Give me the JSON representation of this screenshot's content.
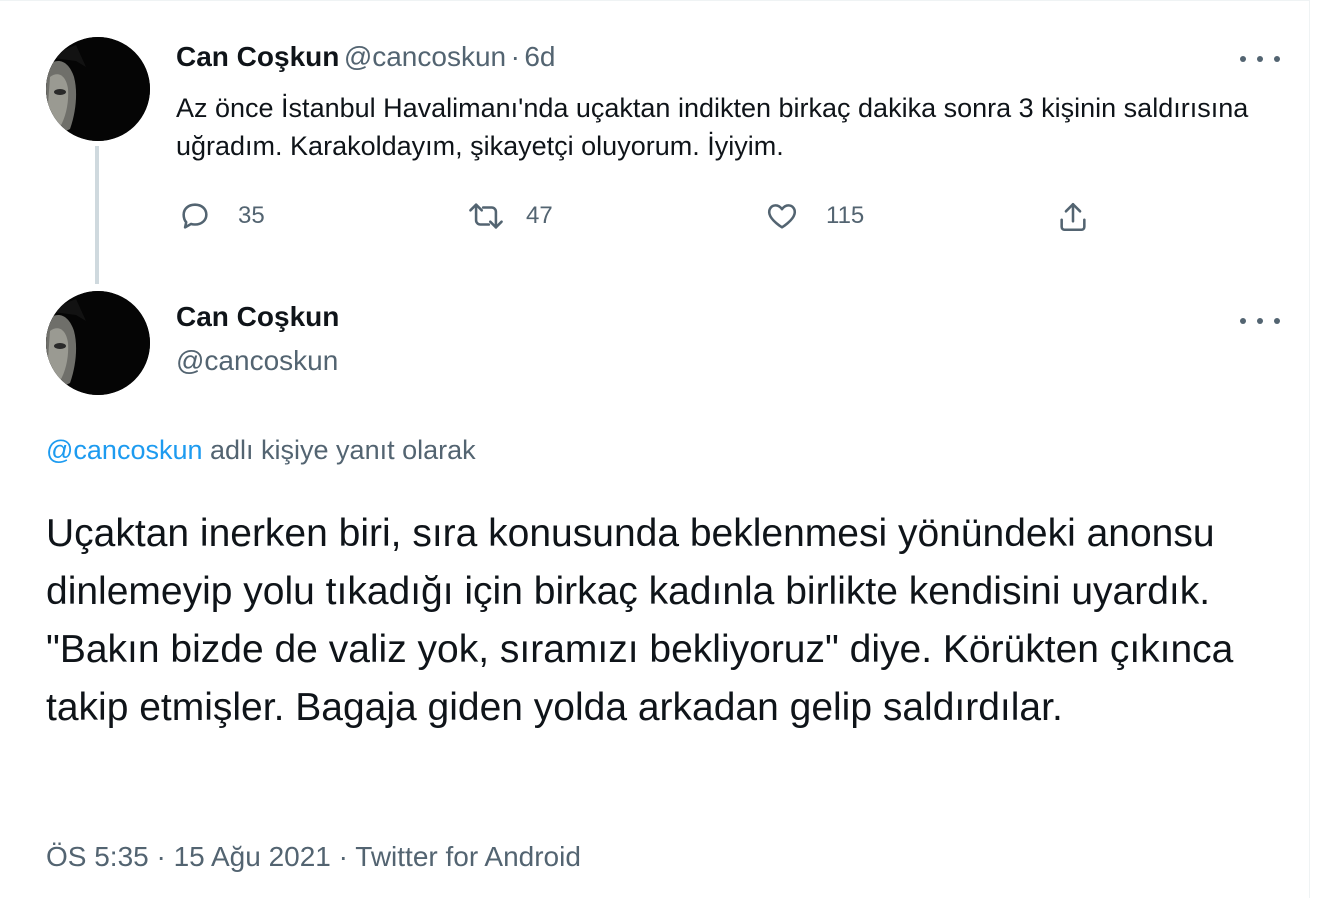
{
  "tweet1": {
    "author_name": "Can Coşkun",
    "author_handle": "@cancoskun",
    "separator": "·",
    "time": "6d",
    "text": "Az önce İstanbul Havalimanı'nda uçaktan indikten birkaç dakika sonra 3 kişinin saldırısına uğradım. Karakoldayım, şikayetçi oluyorum. İyiyim.",
    "replies": "35",
    "retweets": "47",
    "likes": "115",
    "icons": {
      "reply": "reply-icon",
      "retweet": "retweet-icon",
      "like": "heart-icon",
      "share": "share-icon",
      "more": "more-icon"
    }
  },
  "tweet2": {
    "author_name": "Can Coşkun",
    "author_handle": "@cancoskun",
    "reply_to_mention": "@cancoskun",
    "reply_to_suffix": " adlı kişiye yanıt olarak",
    "text": "Uçaktan inerken biri, sıra konusunda beklenmesi yönündeki anonsu dinlemeyip yolu tıkadığı için birkaç kadınla birlikte kendisini uyardık. \"Bakın bizde de valiz yok, sıramızı bekliyoruz\" diye. Körükten çıkınca takip etmişler. Bagaja giden yolda arkadan gelip saldırdılar.",
    "meta": "ÖS 5:35 · 15 Ağu 2021 · Twitter for Android"
  },
  "colors": {
    "text_primary": "#0f1419",
    "text_secondary": "#536471",
    "accent": "#1d9bf0",
    "thread_line": "#cfd9de"
  }
}
